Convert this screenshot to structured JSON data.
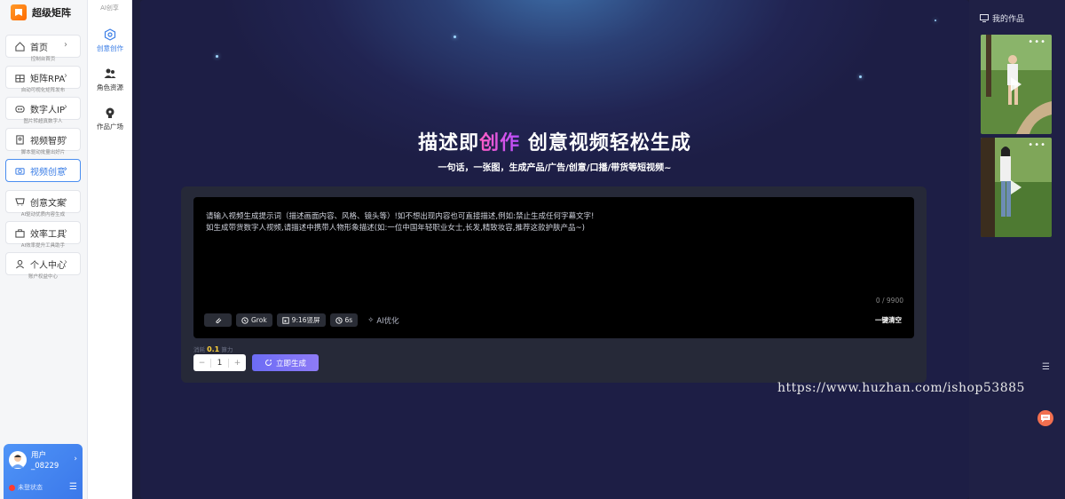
{
  "brand": {
    "name": "超级矩阵"
  },
  "sidebar": {
    "items": [
      {
        "label": "首页",
        "sub": "控制台首页",
        "icon": "home-icon"
      },
      {
        "label": "矩阵RPA",
        "sub": "自动可视化矩阵发布",
        "icon": "rpa-icon"
      },
      {
        "label": "数字人IP",
        "sub": "图片转超真数字人",
        "icon": "digital-human-icon"
      },
      {
        "label": "视频智剪",
        "sub": "脚本驱动批量出好片",
        "icon": "video-edit-icon"
      },
      {
        "label": "视频创意",
        "sub": "",
        "icon": "camera-icon"
      },
      {
        "label": "创意文案",
        "sub": "AI驱动优质内容生成",
        "icon": "copywriting-icon"
      },
      {
        "label": "效率工具",
        "sub": "AI效率提升工具助手",
        "icon": "toolbox-icon"
      },
      {
        "label": "个人中心",
        "sub": "账户权益中心",
        "icon": "user-icon"
      }
    ],
    "active_index": 4
  },
  "user": {
    "name": "用户_08229",
    "status": "未登状态"
  },
  "subnav": {
    "header": "AI创享",
    "items": [
      {
        "label": "创意创作",
        "icon": "create-icon"
      },
      {
        "label": "角色资源",
        "icon": "roles-icon"
      },
      {
        "label": "作品广场",
        "icon": "gallery-icon"
      }
    ]
  },
  "hero": {
    "title_a": "描述即",
    "title_highlight": "创作",
    "title_b": " 创意视频轻松生成",
    "subtitle": "一句话，一张图，生成产品/广告/创意/口播/带货等短视频~"
  },
  "prompt": {
    "placeholder": "请输入视频生成提示词（描述画面内容、风格、镜头等）!如不想出现内容也可直接描述,例如:禁止生成任何字幕文字!\n如生成带货数字人视频,请描述中携带人物形象描述(如:一位中国年轻职业女士,长发,精致妆容,推荐这款护肤产品~)",
    "char_count": "0 / 9900",
    "clear_label": "一键清空",
    "chips": {
      "model": "Grok",
      "ratio": "9:16竖屏",
      "duration": "6s"
    },
    "ai_optimize": "AI优化"
  },
  "cost": {
    "label_a": "消耗",
    "value": "0.1",
    "label_b": "算力"
  },
  "quantity": {
    "minus": "−",
    "value": "1",
    "plus": "+"
  },
  "generate_label": "立即生成",
  "works": {
    "title": "我的作品",
    "menu_dots": "•••"
  },
  "watermark": "https://www.huzhan.com/ishop53885",
  "colors": {
    "accent": "#3a7de6",
    "gen_button": "#7a72f5",
    "highlight": "#d64cff",
    "cost": "#ffd23a"
  }
}
